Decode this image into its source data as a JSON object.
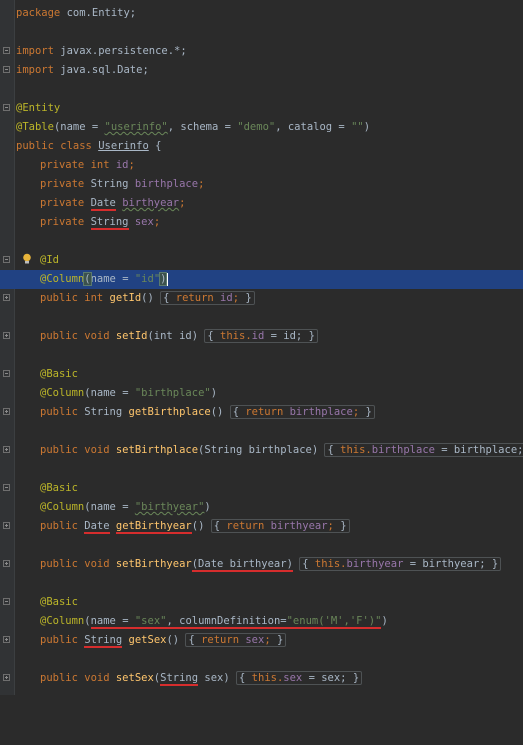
{
  "code": {
    "package_kw": "package",
    "package_name": "com.Entity;",
    "import_kw_1": "import",
    "import_1": "javax.persistence.*;",
    "import_kw_2": "import",
    "import_2": "java.sql.Date;",
    "entity_ann": "@Entity",
    "table_ann": "@Table",
    "table_name_attr": "(name = ",
    "table_name_val": "\"userinfo\"",
    "table_schema_attr": ", schema = ",
    "table_schema_val": "\"demo\"",
    "table_catalog_attr": ", catalog = ",
    "table_catalog_val": "\"\"",
    "table_close": ")",
    "class_kw": "public class ",
    "class_name": "Userinfo",
    "class_open": " {",
    "f1_kw": "private int ",
    "f1_name": "id",
    "f2_kw": "private ",
    "f2_type": "String ",
    "f2_name": "birthplace",
    "f3_kw": "private ",
    "f3_type": "Date",
    "f3_name": "birthyear",
    "f4_kw": "private ",
    "f4_type": "String",
    "f4_name": "sex",
    "semi": ";",
    "id_ann": "@Id",
    "col_ann": "@Column",
    "col_id_attr": "name = ",
    "col_id_val": "\"id\"",
    "getid_kw": "public int ",
    "getid_name": "getId",
    "getid_rest": "() ",
    "getid_body_kw": "return ",
    "getid_body_field": "id",
    "setid_kw": "public void ",
    "setid_name": "setId",
    "setid_params": "(int id) ",
    "setid_body_kw": "this.",
    "setid_body_field": "id",
    "setid_body_rest": " = id; ",
    "basic_ann": "@Basic",
    "col_bp_val": "\"birthplace\"",
    "getbp_kw": "public ",
    "getbp_type": "String ",
    "getbp_name": "getBirthplace",
    "getbp_field": "birthplace",
    "setbp_name": "setBirthplace",
    "setbp_params": "(String birthplace) ",
    "setbp_field": "birthplace",
    "setbp_rest": " = birthplace; ",
    "col_by_val": "\"birthyear\"",
    "getby_type": "Date",
    "getby_name": "getBirthyear",
    "getby_field": "birthyear",
    "setby_name": "setBirthyear",
    "setby_paren_open": "(",
    "setby_type": "Date",
    "setby_param": "birthyear",
    "setby_paren_close": ")",
    "setby_field": "birthyear",
    "setby_rest": " = birthyear; ",
    "col_sex_val": "\"sex\"",
    "col_sex_def_attr": "columnDefinition",
    "col_sex_def_val": "\"enum('M','F')\"",
    "getsex_type": "String",
    "getsex_name": "getSex",
    "getsex_field": "sex",
    "setsex_name": "setSex",
    "setsex_type": "String",
    "setsex_param": "sex",
    "setsex_field": "sex",
    "setsex_rest": " = sex; "
  },
  "colors": {
    "background": "#2b2b2b",
    "keyword": "#cc7832",
    "annotation": "#bbb529",
    "string": "#6a8759",
    "field": "#9876aa",
    "method": "#ffc66d",
    "current_line": "#214283",
    "error_underline": "#d62d2d"
  },
  "icons": {
    "gutter_fold": "fold-toggle-icon",
    "intention": "lightbulb-icon"
  }
}
